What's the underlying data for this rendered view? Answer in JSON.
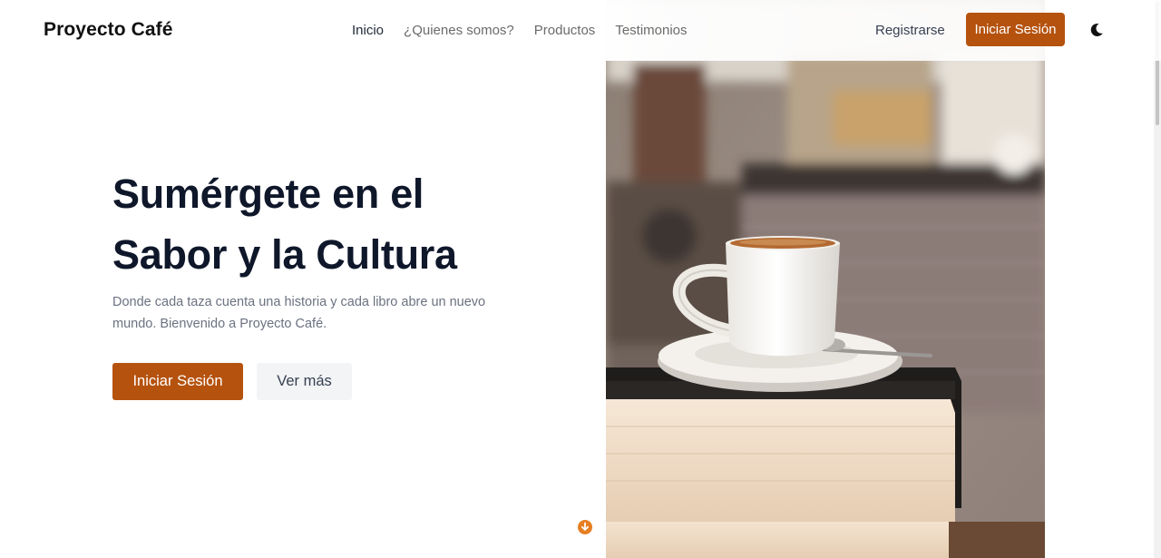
{
  "navbar": {
    "brand": "Proyecto Café",
    "links": [
      {
        "label": "Inicio"
      },
      {
        "label": "¿Quienes somos?"
      },
      {
        "label": "Productos"
      },
      {
        "label": "Testimonios"
      }
    ],
    "register_label": "Registrarse",
    "login_label": "Iniciar Sesión",
    "theme_icon": "moon-icon"
  },
  "hero": {
    "title_line1": "Sumérgete en el",
    "title_line2": "Sabor y la Cultura",
    "subtitle": "Donde cada taza cuenta una historia y cada libro abre un nuevo mundo. Bienvenido a Proyecto Café.",
    "primary_button": "Iniciar Sesión",
    "secondary_button": "Ver más",
    "image_subject": "coffee-cup-on-books-photo",
    "scroll_icon": "arrow-down-circle-icon"
  },
  "colors": {
    "accent": "#b5520e",
    "scroll_accent": "#e67e22",
    "heading": "#0f172a",
    "muted_text": "#6b7280",
    "secondary_button_bg": "#f3f4f6"
  }
}
